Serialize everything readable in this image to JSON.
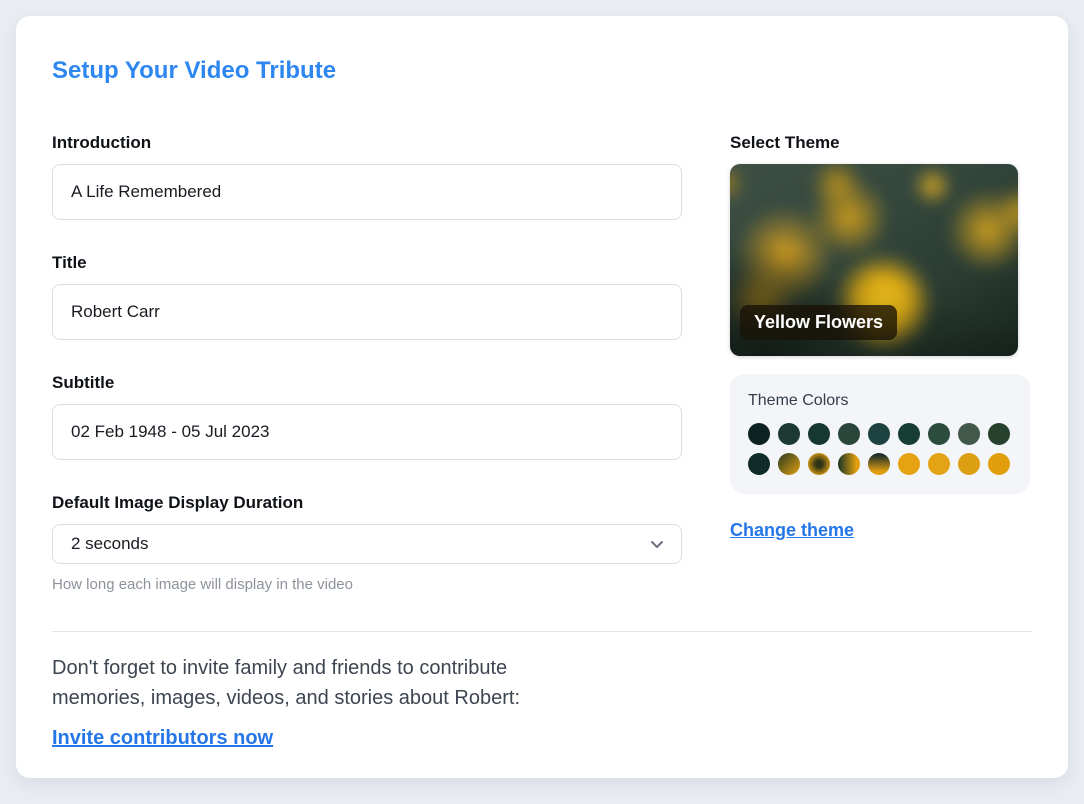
{
  "page": {
    "title": "Setup Your Video Tribute"
  },
  "form": {
    "introduction": {
      "label": "Introduction",
      "value": "A Life Remembered"
    },
    "title": {
      "label": "Title",
      "value": "Robert Carr"
    },
    "subtitle": {
      "label": "Subtitle",
      "value": "02 Feb 1948 - 05 Jul 2023"
    },
    "duration": {
      "label": "Default Image Display Duration",
      "selected_value": "2 seconds",
      "help": "How long each image will display in the video"
    }
  },
  "theme": {
    "section_label": "Select Theme",
    "name": "Yellow Flowers",
    "change_link": "Change theme",
    "palette": {
      "label": "Theme Colors",
      "row1": [
        {
          "style": "solid",
          "color": "#0d2321"
        },
        {
          "style": "solid",
          "color": "#1c3933"
        },
        {
          "style": "solid",
          "color": "#163831"
        },
        {
          "style": "solid",
          "color": "#2a463b"
        },
        {
          "style": "solid",
          "color": "#1e4240"
        },
        {
          "style": "solid",
          "color": "#183d34"
        },
        {
          "style": "solid",
          "color": "#2c4c3e"
        },
        {
          "style": "solid",
          "color": "#42584a"
        },
        {
          "style": "solid",
          "color": "#26412e"
        }
      ],
      "row2": [
        {
          "style": "solid",
          "color": "#0f2c29"
        },
        {
          "style": "diagonal",
          "from": "#27391f",
          "to": "#e0a010"
        },
        {
          "style": "radial",
          "from": "#2e3318",
          "to": "#e0a010"
        },
        {
          "style": "horizontal",
          "from": "#233c24",
          "to": "#e2a010"
        },
        {
          "style": "vertical",
          "from": "#1e3028",
          "to": "#e2a010"
        },
        {
          "style": "solid",
          "color": "#e5a312"
        },
        {
          "style": "solid",
          "color": "#e3a314"
        },
        {
          "style": "solid",
          "color": "#dd9f14"
        },
        {
          "style": "solid",
          "color": "#e19f0b"
        }
      ]
    }
  },
  "footer": {
    "line1": "Don't forget to invite family and friends to contribute",
    "line2": "memories, images, videos, and stories about Robert:",
    "invite_link": "Invite contributors now"
  },
  "colors": {
    "accent": "#2e87f0",
    "link": "#2577e8",
    "panel_bg": "#f3f5f8",
    "page_bg": "#e9edf2"
  }
}
